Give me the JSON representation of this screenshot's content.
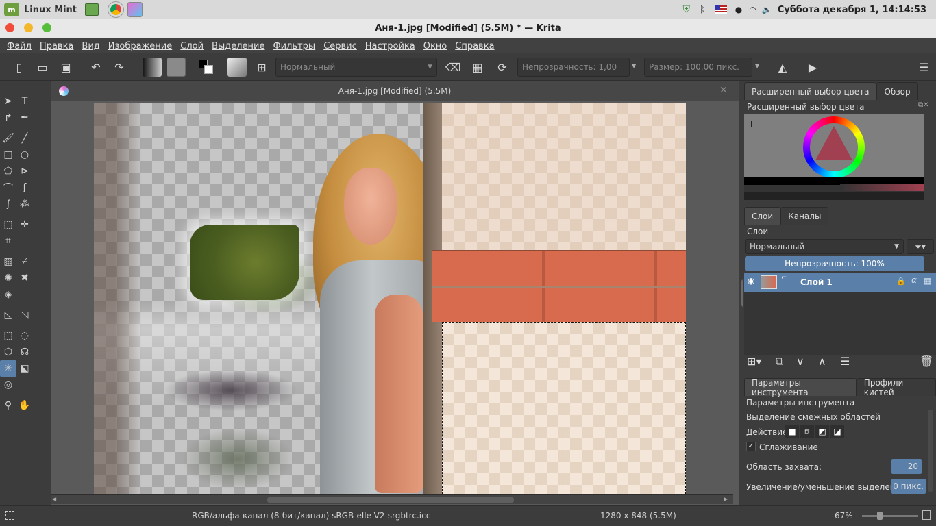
{
  "system_panel": {
    "app_name": "Linux Mint",
    "clock": "Суббота декабря  1, 14:14:53"
  },
  "window": {
    "title": "Аня-1.jpg [Modified]  (5.5M) * — Krita"
  },
  "menu": [
    "Файл",
    "Правка",
    "Вид",
    "Изображение",
    "Слой",
    "Выделение",
    "Фильтры",
    "Сервис",
    "Настройка",
    "Окно",
    "Справка"
  ],
  "toolbar": {
    "blend_mode": "Нормальный",
    "opacity_label": "Непрозрачность:  1,00",
    "size_label": "Размер:  100,00 пикс."
  },
  "document": {
    "tab_title": "Аня-1.jpg [Modified]  (5.5M)"
  },
  "dockers": {
    "top_tabs": [
      "Расширенный выбор цвета",
      "Обзор"
    ],
    "color_selector_title": "Расширенный выбор цвета",
    "layer_tabs": [
      "Слои",
      "Каналы"
    ],
    "layers_title": "Слои",
    "blend_mode": "Нормальный",
    "opacity": "Непрозрачность:  100%",
    "layer_name": "Слой 1",
    "tool_tabs": [
      "Параметры инструмента",
      "Профили кистей"
    ],
    "tool_options_title": "Параметры инструмента",
    "tool_name": "Выделение смежных областей",
    "action_label": "Действие:",
    "antialias_label": "Сглаживание",
    "fuzziness_label": "Область захвата:",
    "fuzziness_value": "20",
    "grow_label": "Увеличение/уменьшение выделения:",
    "grow_value": "0 пикс."
  },
  "status": {
    "color_space": "RGB/альфа-канал (8-бит/канал)  sRGB-elle-V2-srgbtrc.icc",
    "image_size": "1280 x 848 (5.5M)",
    "zoom": "67%"
  },
  "colors": {
    "accent": "#5a7fa8",
    "bg": "#3c3c3c",
    "brick": "#d86a4e"
  }
}
